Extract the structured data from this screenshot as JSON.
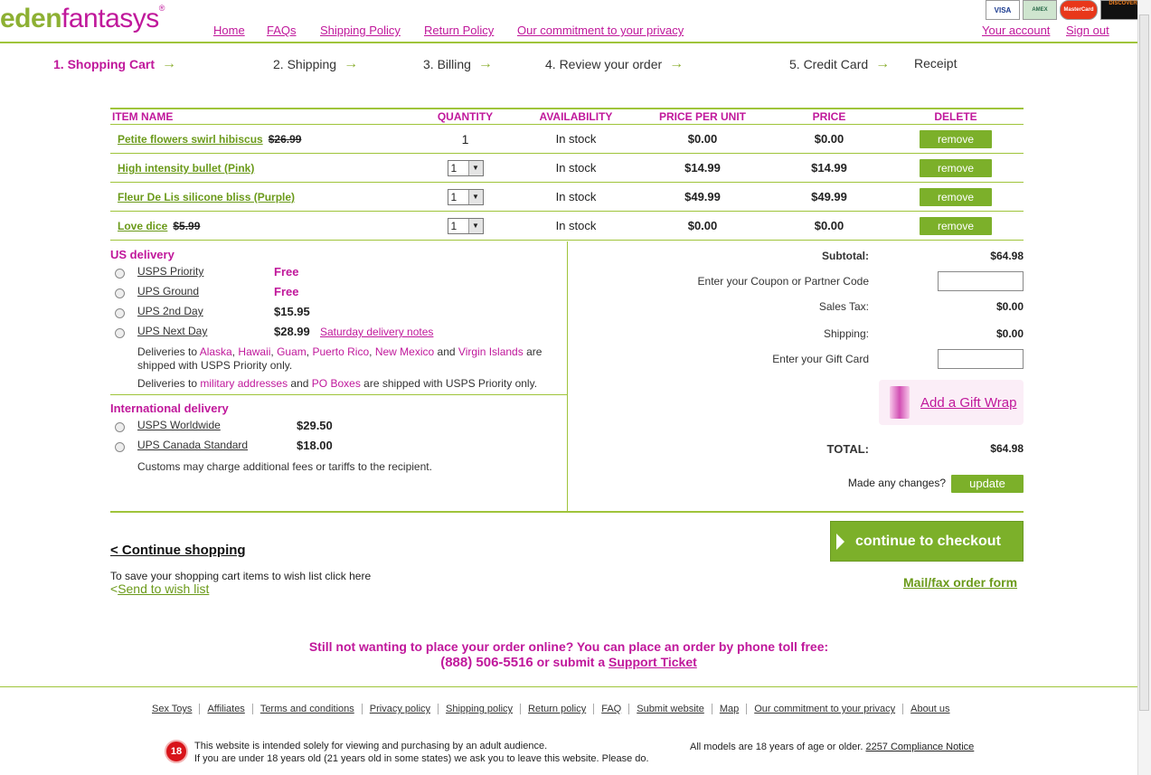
{
  "header": {
    "logo_a": "eden",
    "logo_b": "fantasys",
    "reg": "®",
    "nav": [
      "Home",
      "FAQs",
      "Shipping Policy",
      "Return Policy",
      "Our commitment to your privacy"
    ],
    "account": "Your account",
    "signout": "Sign out",
    "cards": [
      "VISA",
      "AMEX",
      "MasterCard",
      "DISCOVER"
    ]
  },
  "steps": [
    "1. Shopping Cart",
    "2. Shipping",
    "3. Billing",
    "4. Review your order",
    "5. Credit Card",
    "Receipt"
  ],
  "cart": {
    "headers": [
      "ITEM NAME",
      "QUANTITY",
      "AVAILABILITY",
      "PRICE PER UNIT",
      "PRICE",
      "DELETE"
    ],
    "items": [
      {
        "name": "Petite flowers swirl hibiscus",
        "orig_price": "$26.99",
        "qty": "1",
        "qty_select": false,
        "availability": "In stock",
        "ppu": "$0.00",
        "price": "$0.00",
        "remove": "remove"
      },
      {
        "name": "High intensity bullet (Pink)",
        "orig_price": "",
        "qty": "1",
        "qty_select": true,
        "availability": "In stock",
        "ppu": "$14.99",
        "price": "$14.99",
        "remove": "remove"
      },
      {
        "name": "Fleur De Lis silicone bliss (Purple)",
        "orig_price": "",
        "qty": "1",
        "qty_select": true,
        "availability": "In stock",
        "ppu": "$49.99",
        "price": "$49.99",
        "remove": "remove"
      },
      {
        "name": "Love dice",
        "orig_price": "$5.99",
        "qty": "1",
        "qty_select": true,
        "availability": "In stock",
        "ppu": "$0.00",
        "price": "$0.00",
        "remove": "remove"
      }
    ]
  },
  "us_delivery": {
    "title": "US delivery",
    "options": [
      {
        "name": "USPS Priority",
        "price": "Free",
        "free": true
      },
      {
        "name": "UPS Ground",
        "price": "Free",
        "free": true
      },
      {
        "name": "UPS 2nd Day",
        "price": "$15.95",
        "free": false
      },
      {
        "name": "UPS Next Day",
        "price": "$28.99",
        "free": false
      }
    ],
    "saturday_link": "Saturday delivery notes",
    "note1_pre": "Deliveries to",
    "note1_places": [
      "Alaska",
      "Hawaii",
      "Guam",
      "Puerto Rico",
      "New Mexico"
    ],
    "note1_and": "and",
    "note1_last": "Virgin Islands",
    "note1_post": "are shipped with USPS Priority only.",
    "note2_pre": "Deliveries to",
    "note2_a": "military addresses",
    "note2_and": "and",
    "note2_b": "PO Boxes",
    "note2_post": "are shipped with USPS Priority only."
  },
  "intl_delivery": {
    "title": "International delivery",
    "options": [
      {
        "name": "USPS Worldwide",
        "price": "$29.50"
      },
      {
        "name": "UPS Canada Standard",
        "price": "$18.00"
      }
    ],
    "note": "Customs may charge additional fees or tariffs to the recipient."
  },
  "summary": {
    "subtotal_label": "Subtotal:",
    "subtotal": "$64.98",
    "coupon_label": "Enter your Coupon or Partner Code",
    "tax_label": "Sales Tax:",
    "tax": "$0.00",
    "shipping_label": "Shipping:",
    "shipping": "$0.00",
    "gift_label": "Enter your Gift Card",
    "gift_wrap": "Add a Gift Wrap",
    "total_label": "TOTAL:",
    "total": "$64.98",
    "changes_label": "Made any changes?",
    "update": "update"
  },
  "actions": {
    "continue_shopping": "< Continue shopping",
    "wishlist_text": "To save your shopping cart items to wish list click here",
    "wishlist_link": "Send to wish list",
    "checkout": "continue to checkout",
    "mailfax": "Mail/fax order form"
  },
  "phone": {
    "line1": "Still not wanting to place your order online? You can place an order by phone toll free:",
    "number": "(888) 506-5516",
    "or": "or submit a",
    "ticket": "Support Ticket"
  },
  "footer": {
    "links": [
      "Sex Toys",
      "Affiliates",
      "Terms and conditions",
      "Privacy policy",
      "Shipping policy",
      "Return policy",
      "FAQ",
      "Submit website",
      "Map",
      "Our commitment to your privacy",
      "About us"
    ],
    "age_badge": "18",
    "adult1": "This website is intended solely for viewing and purchasing by an adult audience.",
    "adult2": "If you are under 18 years old (21 years old in some states) we ask you to leave this website. Please do.",
    "models": "All models are 18 years of age or older.",
    "compliance": "2257 Compliance Notice"
  }
}
